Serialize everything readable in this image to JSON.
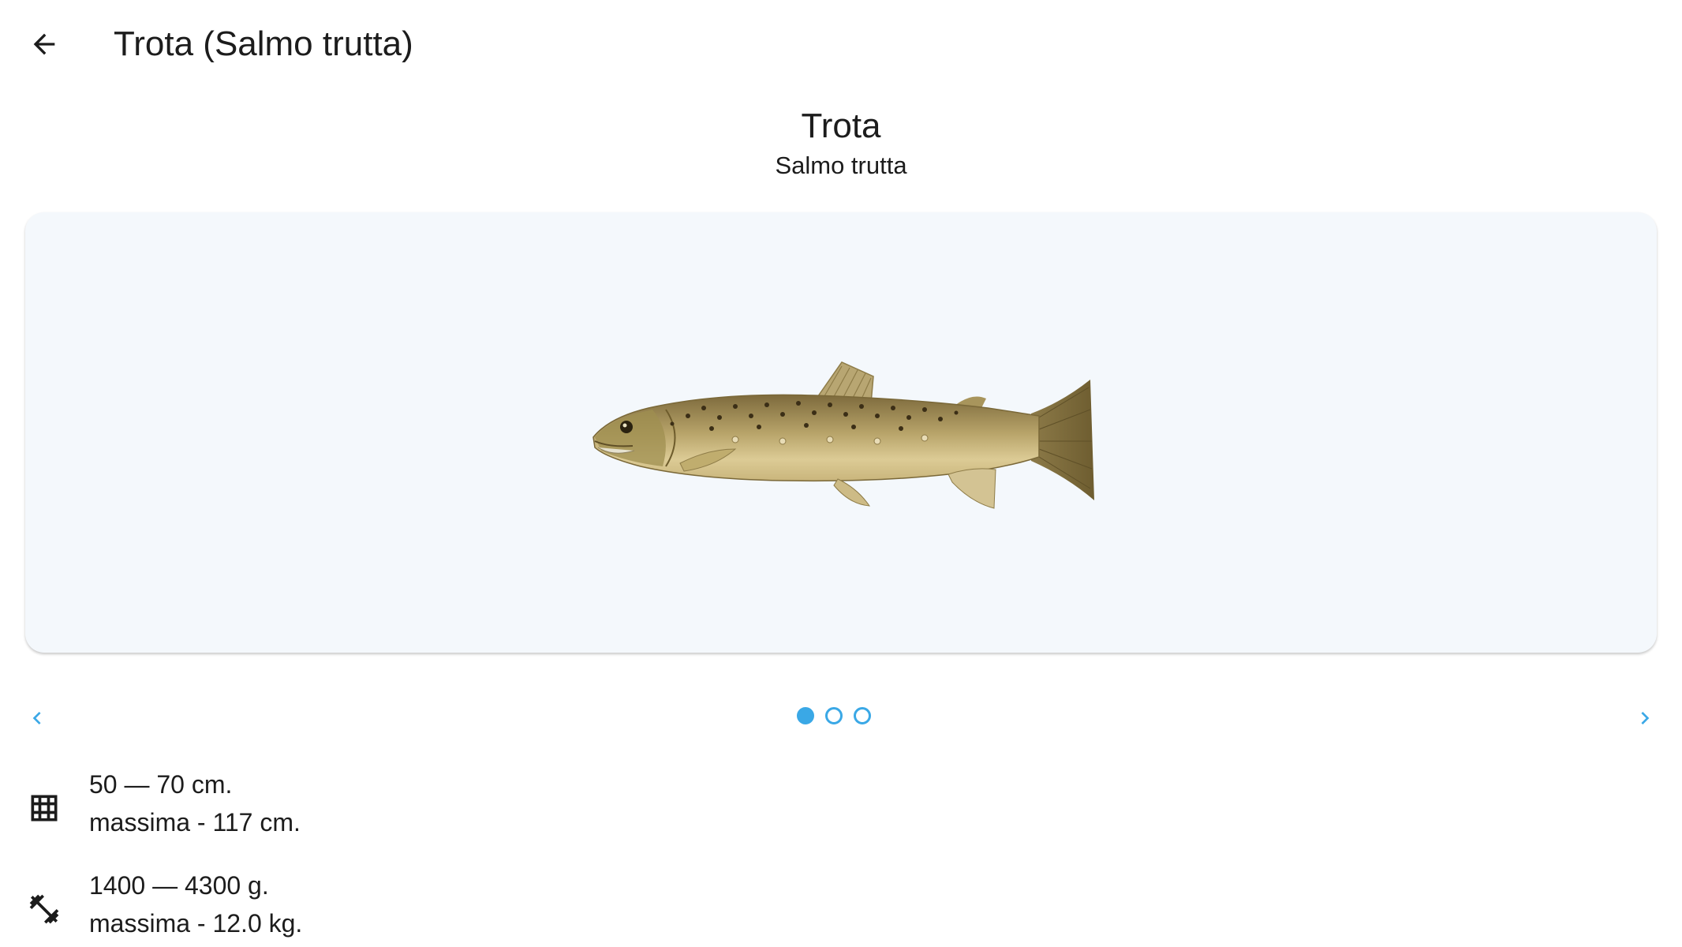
{
  "topbar": {
    "title": "Trota (Salmo trutta)",
    "back_icon": "arrow-left-icon"
  },
  "species": {
    "common_name": "Trota",
    "latin_name": "Salmo trutta"
  },
  "gallery": {
    "image_subject": "brown trout illustration",
    "prev_icon": "chevron-left-icon",
    "next_icon": "chevron-right-icon",
    "page_count": 3,
    "active_page": 1,
    "accent_color": "#3aa8e6",
    "card_background": "#f4f8fc"
  },
  "details": {
    "size": {
      "icon": "grid-icon",
      "range": "50 — 70 cm.",
      "max": "massima - 117 cm."
    },
    "weight": {
      "icon": "dumbbell-icon",
      "range": "1400 — 4300 g.",
      "max": "massima - 12.0 kg."
    }
  }
}
